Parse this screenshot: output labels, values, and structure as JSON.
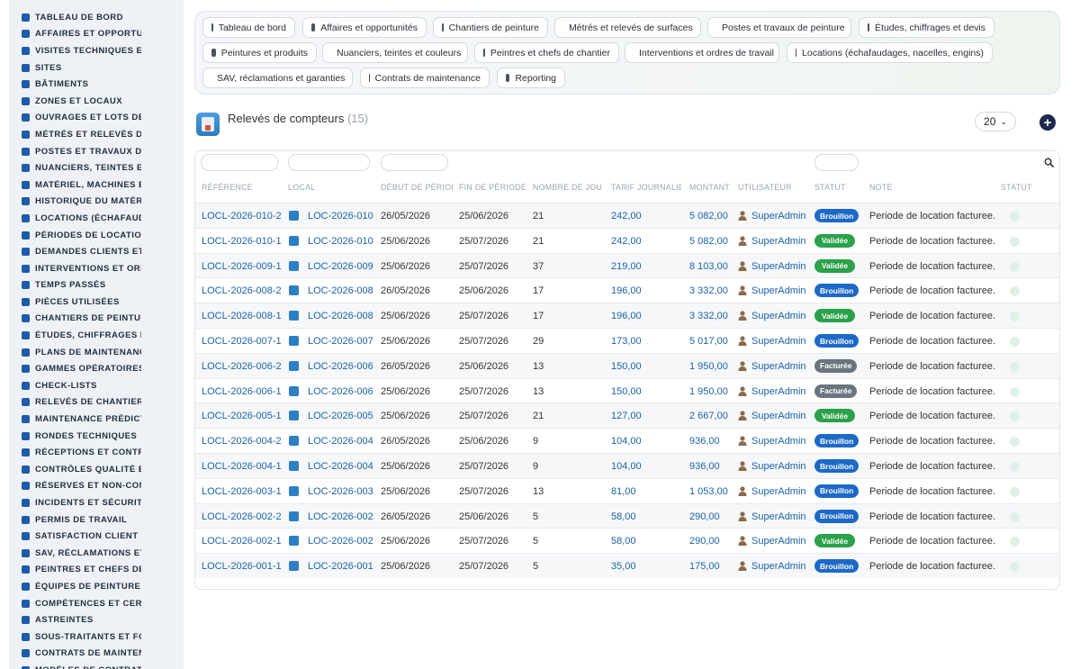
{
  "sidebar": {
    "items": [
      {
        "label": "TABLEAU DE BORD",
        "icon": "dashboard-icon"
      },
      {
        "label": "AFFAIRES ET OPPORTUNITÉS",
        "icon": "target-icon"
      },
      {
        "label": "VISITES TECHNIQUES ET DIAGNOSTICS",
        "icon": "clipboard-icon"
      },
      {
        "label": "SITES",
        "icon": "location-pin-icon"
      },
      {
        "label": "BÂTIMENTS",
        "icon": "building-icon"
      },
      {
        "label": "ZONES ET LOCAUX",
        "icon": "grid-icon"
      },
      {
        "label": "OUVRAGES ET LOTS DE TRAVAUX",
        "icon": "sitemap-icon"
      },
      {
        "label": "MÉTRÉS ET RELEVÉS DE SURFACES",
        "icon": "ruler-icon"
      },
      {
        "label": "POSTES ET TRAVAUX DE PEINTURE",
        "icon": "paint-roller-icon"
      },
      {
        "label": "NUANCIERS, TEINTES ET COULEURS",
        "icon": "palette-icon"
      },
      {
        "label": "MATÉRIEL, MACHINES ET OUTILLAGE",
        "icon": "gears-icon"
      },
      {
        "label": "HISTORIQUE DU MATÉRIEL",
        "icon": "history-icon"
      },
      {
        "label": "LOCATIONS (ÉCHAFAUDAGES, NACELLES, ENGINS)",
        "icon": "truck-icon"
      },
      {
        "label": "PÉRIODES DE LOCATION",
        "icon": "calendar-icon"
      },
      {
        "label": "DEMANDES CLIENTS ET INTERVENTIONS",
        "icon": "inbox-icon"
      },
      {
        "label": "INTERVENTIONS ET ORDRES DE TRAVAIL",
        "icon": "clipboard-check-icon"
      },
      {
        "label": "TEMPS PASSÉS",
        "icon": "clock-icon"
      },
      {
        "label": "PIÈCES UTILISÉES",
        "icon": "box-icon"
      },
      {
        "label": "CHANTIERS DE PEINTURE",
        "icon": "hammer-icon"
      },
      {
        "label": "ÉTUDES, CHIFFRAGES ET DEVIS",
        "icon": "network-icon"
      },
      {
        "label": "PLANS DE MAINTENANCE",
        "icon": "calendar-check-icon"
      },
      {
        "label": "GAMMES OPÉRATOIRES",
        "icon": "list-icon"
      },
      {
        "label": "CHECK-LISTS",
        "icon": "checklist-icon"
      },
      {
        "label": "RELEVÉS DE CHANTIER",
        "icon": "file-icon"
      },
      {
        "label": "MAINTENANCE PRÉDICTIVE",
        "icon": "chart-line-icon"
      },
      {
        "label": "RONDES TECHNIQUES",
        "icon": "route-icon"
      },
      {
        "label": "RÉCEPTIONS ET CONTRÔLES",
        "icon": "search-icon"
      },
      {
        "label": "CONTRÔLES QUALITÉ ET AUDITS",
        "icon": "file-check-icon"
      },
      {
        "label": "RÉSERVES ET NON-CONFORMITÉS",
        "icon": "info-icon"
      },
      {
        "label": "INCIDENTS ET SÉCURITÉ",
        "icon": "warning-icon"
      },
      {
        "label": "PERMIS DE TRAVAIL",
        "icon": "document-icon"
      },
      {
        "label": "SATISFACTION CLIENT",
        "icon": "smile-icon"
      },
      {
        "label": "SAV, RÉCLAMATIONS ET GARANTIES",
        "icon": "comment-icon"
      },
      {
        "label": "PEINTRES ET CHEFS DE CHANTIER",
        "icon": "hard-hat-icon"
      },
      {
        "label": "ÉQUIPES DE PEINTURE",
        "icon": "users-icon"
      },
      {
        "label": "COMPÉTENCES ET CERTIFICATIONS",
        "icon": "certificate-icon"
      },
      {
        "label": "ASTREINTES",
        "icon": "phone-icon"
      },
      {
        "label": "SOUS-TRAITANTS ET FOURNISSEURS",
        "icon": "handshake-icon"
      },
      {
        "label": "CONTRATS DE MAINTENANCE",
        "icon": "contract-icon"
      },
      {
        "label": "MODÈLES DE CONTRATS",
        "icon": "template-icon"
      }
    ]
  },
  "topnav": {
    "tabs": [
      {
        "label": "Tableau de bord",
        "icon": "dashboard-icon"
      },
      {
        "label": "Affaires et opportunités",
        "icon": "target-icon"
      },
      {
        "label": "Chantiers de peinture",
        "icon": "hammer-icon"
      },
      {
        "label": "Métrés et relevés de surfaces",
        "icon": "ruler-icon"
      },
      {
        "label": "Postes et travaux de peinture",
        "icon": "paint-roller-icon"
      },
      {
        "label": "Études, chiffrages et devis",
        "icon": "network-icon"
      },
      {
        "label": "Peintures et produits",
        "icon": "paint-bucket-icon"
      },
      {
        "label": "Nuanciers, teintes et couleurs",
        "icon": "palette-icon"
      },
      {
        "label": "Peintres et chefs de chantier",
        "icon": "hard-hat-icon"
      },
      {
        "label": "Interventions et ordres de travail",
        "icon": "clipboard-check-icon"
      },
      {
        "label": "Locations (échafaudages, nacelles, engins)",
        "icon": "truck-icon"
      },
      {
        "label": "SAV, réclamations et garanties",
        "icon": "comment-icon"
      },
      {
        "label": "Contrats de maintenance",
        "icon": "contract-icon"
      },
      {
        "label": "Reporting",
        "icon": "pie-chart-icon"
      }
    ]
  },
  "page": {
    "title": "Relevés de compteurs",
    "count": "(15)",
    "per_page": "20",
    "add_label": "+"
  },
  "table": {
    "headers": [
      "RÉFÉRENCE",
      "LOCAL",
      "DÉBUT DE PÉRIODE",
      "FIN DE PÉRIODE",
      "NOMBRE DE JOURS",
      "TARIF JOURNALIER",
      "MONTANT",
      "UTILISATEUR",
      "STATUT",
      "NOTE",
      "STATUT"
    ],
    "rows": [
      {
        "ref": "LOCL-2026-010-2",
        "local": "LOC-2026-010",
        "debut": "26/05/2026",
        "fin": "25/06/2026",
        "jours": "21",
        "tarif": "242,00",
        "montant": "5 082,00",
        "user": "SuperAdmin",
        "statut": "Brouillon",
        "note": "Periode de location facturee."
      },
      {
        "ref": "LOCL-2026-010-1",
        "local": "LOC-2026-010",
        "debut": "25/06/2026",
        "fin": "25/07/2026",
        "jours": "21",
        "tarif": "242,00",
        "montant": "5 082,00",
        "user": "SuperAdmin",
        "statut": "Validée",
        "note": "Periode de location facturee."
      },
      {
        "ref": "LOCL-2026-009-1",
        "local": "LOC-2026-009",
        "debut": "25/06/2026",
        "fin": "25/07/2026",
        "jours": "37",
        "tarif": "219,00",
        "montant": "8 103,00",
        "user": "SuperAdmin",
        "statut": "Validée",
        "note": "Periode de location facturee."
      },
      {
        "ref": "LOCL-2026-008-2",
        "local": "LOC-2026-008",
        "debut": "26/05/2026",
        "fin": "25/06/2026",
        "jours": "17",
        "tarif": "196,00",
        "montant": "3 332,00",
        "user": "SuperAdmin",
        "statut": "Brouillon",
        "note": "Periode de location facturee."
      },
      {
        "ref": "LOCL-2026-008-1",
        "local": "LOC-2026-008",
        "debut": "25/06/2026",
        "fin": "25/07/2026",
        "jours": "17",
        "tarif": "196,00",
        "montant": "3 332,00",
        "user": "SuperAdmin",
        "statut": "Validée",
        "note": "Periode de location facturee."
      },
      {
        "ref": "LOCL-2026-007-1",
        "local": "LOC-2026-007",
        "debut": "25/06/2026",
        "fin": "25/07/2026",
        "jours": "29",
        "tarif": "173,00",
        "montant": "5 017,00",
        "user": "SuperAdmin",
        "statut": "Brouillon",
        "note": "Periode de location facturee."
      },
      {
        "ref": "LOCL-2026-006-2",
        "local": "LOC-2026-006",
        "debut": "26/05/2026",
        "fin": "25/06/2026",
        "jours": "13",
        "tarif": "150,00",
        "montant": "1 950,00",
        "user": "SuperAdmin",
        "statut": "Facturée",
        "note": "Periode de location facturee."
      },
      {
        "ref": "LOCL-2026-006-1",
        "local": "LOC-2026-006",
        "debut": "25/06/2026",
        "fin": "25/07/2026",
        "jours": "13",
        "tarif": "150,00",
        "montant": "1 950,00",
        "user": "SuperAdmin",
        "statut": "Facturée",
        "note": "Periode de location facturee."
      },
      {
        "ref": "LOCL-2026-005-1",
        "local": "LOC-2026-005",
        "debut": "25/06/2026",
        "fin": "25/07/2026",
        "jours": "21",
        "tarif": "127,00",
        "montant": "2 667,00",
        "user": "SuperAdmin",
        "statut": "Validée",
        "note": "Periode de location facturee."
      },
      {
        "ref": "LOCL-2026-004-2",
        "local": "LOC-2026-004",
        "debut": "26/05/2026",
        "fin": "25/06/2026",
        "jours": "9",
        "tarif": "104,00",
        "montant": "936,00",
        "user": "SuperAdmin",
        "statut": "Brouillon",
        "note": "Periode de location facturee."
      },
      {
        "ref": "LOCL-2026-004-1",
        "local": "LOC-2026-004",
        "debut": "25/06/2026",
        "fin": "25/07/2026",
        "jours": "9",
        "tarif": "104,00",
        "montant": "936,00",
        "user": "SuperAdmin",
        "statut": "Brouillon",
        "note": "Periode de location facturee."
      },
      {
        "ref": "LOCL-2026-003-1",
        "local": "LOC-2026-003",
        "debut": "25/06/2026",
        "fin": "25/07/2026",
        "jours": "13",
        "tarif": "81,00",
        "montant": "1 053,00",
        "user": "SuperAdmin",
        "statut": "Brouillon",
        "note": "Periode de location facturee."
      },
      {
        "ref": "LOCL-2026-002-2",
        "local": "LOC-2026-002",
        "debut": "26/05/2026",
        "fin": "25/06/2026",
        "jours": "5",
        "tarif": "58,00",
        "montant": "290,00",
        "user": "SuperAdmin",
        "statut": "Brouillon",
        "note": "Periode de location facturee."
      },
      {
        "ref": "LOCL-2026-002-1",
        "local": "LOC-2026-002",
        "debut": "25/06/2026",
        "fin": "25/07/2026",
        "jours": "5",
        "tarif": "58,00",
        "montant": "290,00",
        "user": "SuperAdmin",
        "statut": "Validée",
        "note": "Periode de location facturee."
      },
      {
        "ref": "LOCL-2026-001-1",
        "local": "LOC-2026-001",
        "debut": "25/06/2026",
        "fin": "25/07/2026",
        "jours": "5",
        "tarif": "35,00",
        "montant": "175,00",
        "user": "SuperAdmin",
        "statut": "Brouillon",
        "note": "Periode de location facturee."
      }
    ]
  },
  "colors": {
    "brouillon": "#1d69c8",
    "validee": "#2aa14a",
    "facturee": "#6c757d",
    "link": "#1b63a8",
    "sidebar_bg": "#eef2f7"
  }
}
